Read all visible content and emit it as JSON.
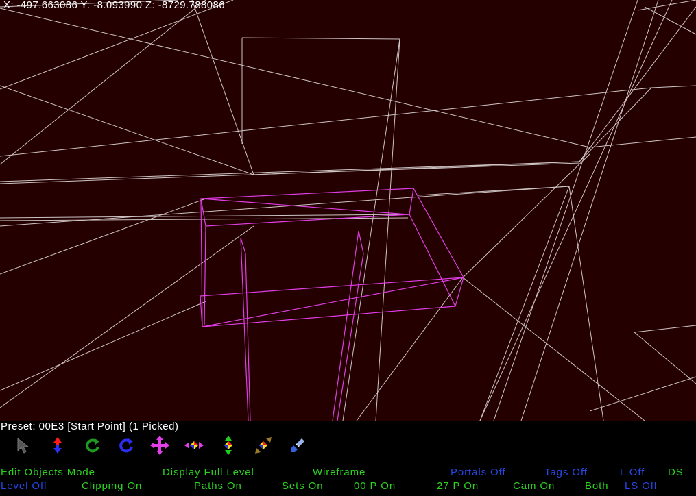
{
  "viewport": {
    "coordinates": "X: -497.663086 Y: -8.093990 Z: -8729.788086",
    "background_color": "#240000",
    "wire_color": "#cfc5c5",
    "selection_color": "#e03ee6"
  },
  "panel": {
    "preset_line": "Preset: 00E3  [Start Point] (1 Picked)",
    "tools": [
      {
        "icon": "select-arrow-icon"
      },
      {
        "icon": "move-vertical-arrows-icon"
      },
      {
        "icon": "rotate-green-icon"
      },
      {
        "icon": "rotate-blue-icon"
      },
      {
        "icon": "move-all-directions-icon"
      },
      {
        "icon": "scale-horizontal-icon"
      },
      {
        "icon": "scale-vertical-icon"
      },
      {
        "icon": "scale-diagonal-icon"
      },
      {
        "icon": "paint-brush-icon"
      }
    ],
    "status_row1": {
      "mode": "Edit Objects Mode",
      "display": "Display Full Level",
      "render": "Wireframe",
      "portals": "Portals Off",
      "tags": "Tags Off",
      "l": "L Off",
      "ds": "DS"
    },
    "status_row2": {
      "level": "Level Off",
      "clipping": "Clipping On",
      "paths": "Paths On",
      "sets": "Sets On",
      "p00": "00 P On",
      "p27": "27 P On",
      "cam": "Cam On",
      "both": "Both",
      "ls": "LS Off"
    },
    "colors": {
      "green": "#2bd31e",
      "blue": "#2647e4",
      "white": "#ffffff"
    }
  }
}
